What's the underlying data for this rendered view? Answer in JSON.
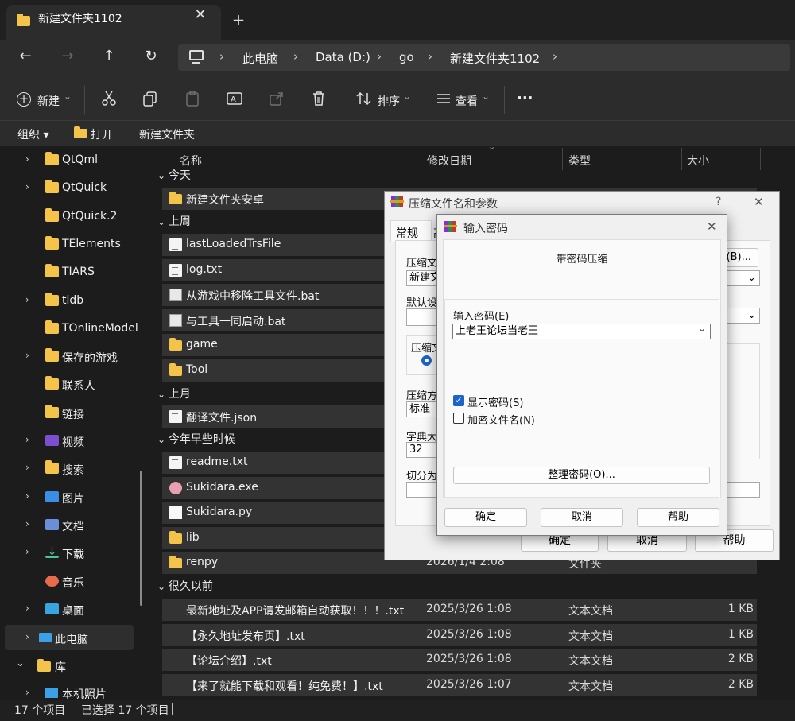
{
  "window": {
    "tab_title": "新建文件夹1102",
    "close_glyph": "✕",
    "new_tab_glyph": "+"
  },
  "address": {
    "back": "←",
    "forward": "→",
    "up": "↑",
    "refresh": "↻",
    "crumbs": [
      "此电脑",
      "Data (D:)",
      "go",
      "新建文件夹1102"
    ],
    "sep": "›"
  },
  "toolbar": {
    "new_label": "新建",
    "sort_label": "排序",
    "view_label": "查看",
    "more_label": "···",
    "caret": "⌄"
  },
  "cmdbar": {
    "organize": "组织 ▾",
    "open": "打开",
    "new_folder": "新建文件夹"
  },
  "sidebar": {
    "items": [
      {
        "label": "QtQml",
        "chev": "›",
        "icon": "folder-icon"
      },
      {
        "label": "QtQuick",
        "chev": "›",
        "icon": "folder-icon"
      },
      {
        "label": "QtQuick.2",
        "chev": "",
        "icon": "folder-icon"
      },
      {
        "label": "TElements",
        "chev": "",
        "icon": "folder-icon"
      },
      {
        "label": "TIARS",
        "chev": "",
        "icon": "folder-icon"
      },
      {
        "label": "tldb",
        "chev": "›",
        "icon": "folder-icon"
      },
      {
        "label": "TOnlineModel",
        "chev": "",
        "icon": "folder-icon"
      },
      {
        "label": "保存的游戏",
        "chev": "›",
        "icon": "folder-icon"
      },
      {
        "label": "联系人",
        "chev": "",
        "icon": "folder-icon"
      },
      {
        "label": "链接",
        "chev": "",
        "icon": "folder-icon"
      },
      {
        "label": "视频",
        "chev": "›",
        "icon": "video-icon"
      },
      {
        "label": "搜索",
        "chev": "›",
        "icon": "folder-icon"
      },
      {
        "label": "图片",
        "chev": "›",
        "icon": "picture-icon"
      },
      {
        "label": "文档",
        "chev": "›",
        "icon": "document-icon"
      },
      {
        "label": "下载",
        "chev": "›",
        "icon": "download-icon"
      },
      {
        "label": "音乐",
        "chev": "",
        "icon": "music-icon"
      },
      {
        "label": "桌面",
        "chev": "›",
        "icon": "desktop-icon"
      }
    ],
    "this_pc": "此电脑",
    "library": "库",
    "photos": "本机照片",
    "chev_right": "›",
    "chev_down": "⌄"
  },
  "columns": {
    "name": "名称",
    "date": "修改日期",
    "type": "类型",
    "size": "大小"
  },
  "groups": {
    "today": "今天",
    "last_week": "上周",
    "last_month": "上月",
    "earlier_year": "今年早些时候",
    "long_ago": "很久以前"
  },
  "files": {
    "today": [
      {
        "name": "新建文件夹安卓",
        "icon": "folder"
      }
    ],
    "last_week": [
      {
        "name": "lastLoadedTrsFile",
        "icon": "file"
      },
      {
        "name": "log.txt",
        "icon": "txt"
      },
      {
        "name": "从游戏中移除工具文件.bat",
        "icon": "bat"
      },
      {
        "name": "与工具一同启动.bat",
        "icon": "bat"
      },
      {
        "name": "game",
        "icon": "folder"
      },
      {
        "name": "Tool",
        "icon": "folder"
      }
    ],
    "last_month": [
      {
        "name": "翻译文件.json",
        "icon": "txt"
      }
    ],
    "earlier_year": [
      {
        "name": "readme.txt",
        "icon": "txt"
      },
      {
        "name": "Sukidara.exe",
        "icon": "exe"
      },
      {
        "name": "Sukidara.py",
        "icon": "py"
      },
      {
        "name": "lib",
        "icon": "folder"
      },
      {
        "name": "renpy",
        "icon": "folder",
        "date": "2026/1/4 2:08",
        "type": "文件夹"
      }
    ],
    "long_ago": [
      {
        "name": "最新地址及APP请发邮箱自动获取！！！.txt",
        "date": "2025/3/26 1:08",
        "type": "文本文档",
        "size": "1 KB"
      },
      {
        "name": "【永久地址发布页】.txt",
        "date": "2025/3/26 1:08",
        "type": "文本文档",
        "size": "1 KB"
      },
      {
        "name": "【论坛介绍】.txt",
        "date": "2025/3/26 1:08",
        "type": "文本文档",
        "size": "2 KB"
      },
      {
        "name": "【来了就能下载和观看！纯免费！】.txt",
        "date": "2025/3/26 1:07",
        "type": "文本文档",
        "size": "2 KB"
      }
    ]
  },
  "status": {
    "count": "17 个项目",
    "selected": "已选择 17 个项目"
  },
  "archive_dialog": {
    "title": "压缩文件名和参数",
    "help_glyph": "?",
    "close_glyph": "✕",
    "tab_general": "常规",
    "tab_partial": "高",
    "archive_name_label": "压缩文",
    "archive_name_value": "新建文",
    "browse_label": "(B)...",
    "default_settings_label": "默认设",
    "format_label": "压缩文",
    "format_option": "R",
    "method_label": "压缩方",
    "method_value": "标准",
    "dict_label": "字典大",
    "dict_value": "32",
    "split_label": "切分为",
    "ok": "确定",
    "cancel": "取消",
    "help": "帮助"
  },
  "password_dialog": {
    "title": "输入密码",
    "close_glyph": "✕",
    "header": "带密码压缩",
    "enter_label": "输入密码(E)",
    "password_value": "上老王论坛当老王",
    "show_password": "显示密码(S)",
    "encrypt_names": "加密文件名(N)",
    "organize_button": "整理密码(O)...",
    "ok": "确定",
    "cancel": "取消",
    "help": "帮助",
    "check": "✓",
    "dropdown": "⌄"
  },
  "colors": {
    "folder": "#f3c34a",
    "accent": "#1e63c6",
    "row_bg": "#333333"
  }
}
